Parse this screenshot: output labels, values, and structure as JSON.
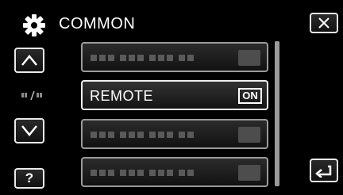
{
  "header": {
    "title": "COMMON",
    "icon": "gear-icon"
  },
  "nav": {
    "help_label": "?"
  },
  "menu": {
    "items": [
      {
        "label": "",
        "value": ""
      },
      {
        "label": "REMOTE",
        "value": "ON"
      },
      {
        "label": "",
        "value": ""
      },
      {
        "label": "",
        "value": ""
      }
    ],
    "selected_index": 1
  },
  "colors": {
    "background": "#000000",
    "text": "#ffffff",
    "button_border": "#e9e9e9",
    "item_border": "#9a9a9a",
    "placeholder": "#5a5a5a"
  }
}
